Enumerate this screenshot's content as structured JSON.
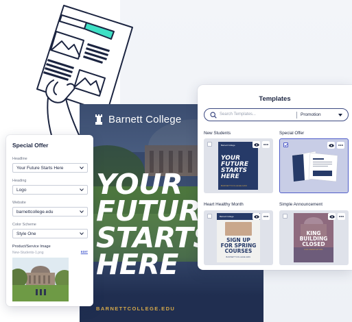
{
  "poster": {
    "brand": "Barnett College",
    "headline": [
      "YOUR",
      "FUTURE",
      "STARTS",
      "HERE"
    ],
    "url": "BARNETTCOLLEGE.EDU"
  },
  "offer_panel": {
    "title": "Special Offer",
    "fields": [
      {
        "label": "Headline",
        "value": "Your Future Starts Here"
      },
      {
        "label": "Heading",
        "value": "Logo"
      },
      {
        "label": "Website",
        "value": "barnettcollege.edu"
      },
      {
        "label": "Color Scheme",
        "value": "Style One"
      }
    ],
    "image_label": "Product/Service Image",
    "image_file": "New-Students-1.png",
    "edit_label": "EDIT"
  },
  "templates": {
    "title": "Templates",
    "search_placeholder": "Search Templates...",
    "category": "Promotion",
    "cards": [
      {
        "label": "New Students",
        "selected": false
      },
      {
        "label": "Special Offer",
        "selected": true
      },
      {
        "label": "Heart Healthy Month",
        "selected": false
      },
      {
        "label": "Simple Announcement",
        "selected": false
      }
    ],
    "thumb_new_students": {
      "brand": "Barnett College",
      "headline": [
        "YOUR",
        "FUTURE",
        "STARTS",
        "HERE"
      ],
      "url": "BARNETTCOLLEGE.EDU"
    },
    "thumb_heart": {
      "brand": "Barnett College",
      "headline": [
        "SIGN UP",
        "FOR SPRING",
        "COURSES"
      ],
      "url": "BARNETTCOLLEGE.EDU"
    },
    "thumb_simple": {
      "headline": [
        "KING",
        "BUILDING",
        "CLOSED"
      ],
      "sub": "FOR RENOVATION"
    }
  },
  "colors": {
    "navy": "#243457",
    "gold": "#d6a94a",
    "accent": "#4f5cc8",
    "teal": "#3fe0c5"
  },
  "icons": {
    "search": "search-icon",
    "eye": "eye-icon",
    "more": "more-icon",
    "rook": "rook-icon",
    "chevron": "chevron-down-icon"
  }
}
